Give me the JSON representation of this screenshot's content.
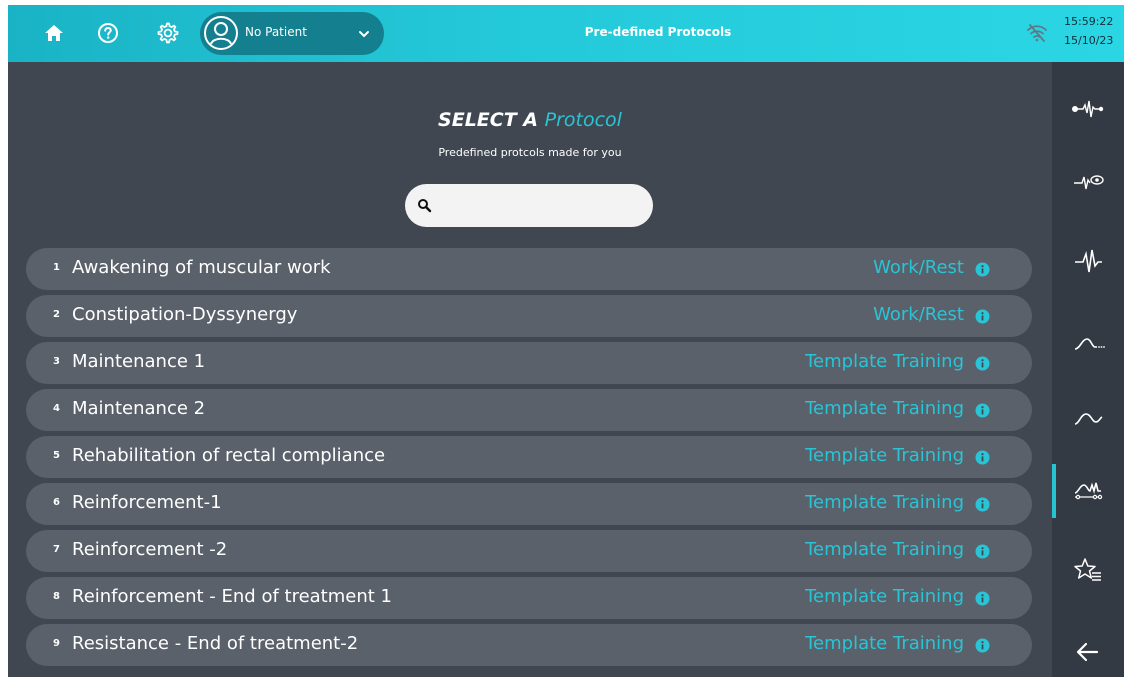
{
  "header": {
    "title": "Pre-defined Protocols",
    "patient": "No Patient",
    "time": "15:59:22",
    "date": "15/10/23",
    "icons": [
      "home-icon",
      "help-icon",
      "settings-icon",
      "user-icon",
      "chevron-down-icon",
      "wifi-off-icon"
    ]
  },
  "main": {
    "heading_prefix": "SELECT A",
    "heading_accent": "Protocol",
    "subheading": "Predefined protcols made for you",
    "search_value": ""
  },
  "protocols": [
    {
      "num": "1",
      "name": "Awakening of muscular work",
      "type": "Work/Rest"
    },
    {
      "num": "2",
      "name": "Constipation-Dyssynergy",
      "type": "Work/Rest"
    },
    {
      "num": "3",
      "name": "Maintenance 1",
      "type": "Template Training"
    },
    {
      "num": "4",
      "name": "Maintenance 2",
      "type": "Template Training"
    },
    {
      "num": "5",
      "name": "Rehabilitation of rectal compliance",
      "type": "Template Training"
    },
    {
      "num": "6",
      "name": "Reinforcement-1",
      "type": "Template Training"
    },
    {
      "num": "7",
      "name": "Reinforcement -2",
      "type": "Template Training"
    },
    {
      "num": "8",
      "name": "Reinforcement - End of treatment 1",
      "type": "Template Training"
    },
    {
      "num": "9",
      "name": "Resistance - End of treatment-2",
      "type": "Template Training"
    }
  ],
  "sidebar": {
    "items": [
      "emg-signal-icon",
      "emg-view-icon",
      "pulse-icon",
      "curve-icon",
      "wave-icon",
      "protocols-icon",
      "favorites-icon",
      "back-arrow-icon"
    ],
    "active_index": 5
  },
  "colors": {
    "accent": "#29c4d6",
    "topbar": "#24c9d9",
    "background": "#404751",
    "row": "#5a616b",
    "sidebar": "#333a43"
  }
}
